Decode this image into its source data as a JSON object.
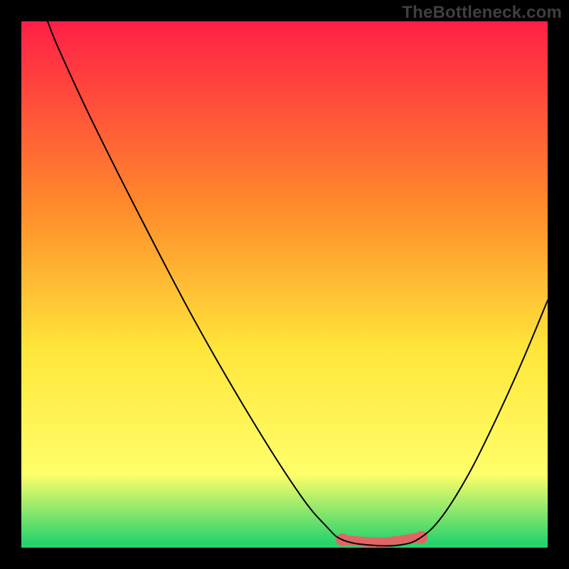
{
  "watermark": "TheBottleneck.com",
  "chart_data": {
    "type": "line",
    "title": "",
    "xlabel": "",
    "ylabel": "",
    "xlim": [
      0,
      100
    ],
    "ylim": [
      0,
      100
    ],
    "background_gradient": {
      "top": "#ff1f46",
      "mid1": "#ff8a2b",
      "mid2": "#ffe53a",
      "mid3": "#ffff6a",
      "bottom": "#28d36d"
    },
    "series": [
      {
        "name": "bottleneck-curve",
        "color": "#000000",
        "points": [
          {
            "x": 5,
            "y": 100
          },
          {
            "x": 7,
            "y": 95
          },
          {
            "x": 13,
            "y": 82
          },
          {
            "x": 22,
            "y": 64
          },
          {
            "x": 33,
            "y": 43
          },
          {
            "x": 44,
            "y": 24
          },
          {
            "x": 53,
            "y": 10
          },
          {
            "x": 58,
            "y": 4
          },
          {
            "x": 61,
            "y": 1.5
          },
          {
            "x": 66,
            "y": 0.5
          },
          {
            "x": 72,
            "y": 0.5
          },
          {
            "x": 76,
            "y": 2
          },
          {
            "x": 80,
            "y": 6
          },
          {
            "x": 85,
            "y": 14
          },
          {
            "x": 90,
            "y": 24
          },
          {
            "x": 95,
            "y": 35
          },
          {
            "x": 100,
            "y": 47
          }
        ]
      }
    ],
    "highlight": {
      "name": "optimal-range",
      "color": "#e06666",
      "start": {
        "x": 61,
        "y": 1.5
      },
      "end": {
        "x": 76,
        "y": 2
      },
      "stroke_width": 14
    }
  }
}
